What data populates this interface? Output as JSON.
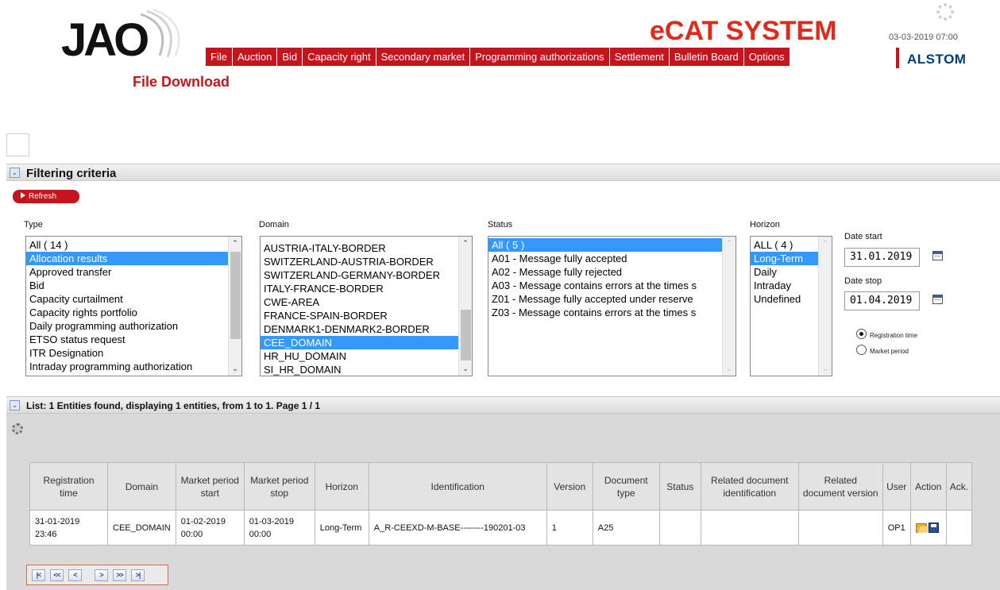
{
  "header": {
    "logo_text": "JAO",
    "page_title": "File Download",
    "system_title": "eCAT SYSTEM",
    "datetime": "03-03-2019 07:00",
    "brand": "ALSTOM",
    "menu": [
      "File",
      "Auction",
      "Bid",
      "Capacity right",
      "Secondary market",
      "Programming authorizations",
      "Settlement",
      "Bulletin Board",
      "Options"
    ],
    "accent_color": "#c4151c"
  },
  "filter": {
    "section_title": "Filtering criteria",
    "refresh_label": "Refresh",
    "type": {
      "label": "Type",
      "options": [
        "All ( 14 )",
        "Allocation results",
        "Approved transfer",
        "Bid",
        "Capacity curtailment",
        "Capacity rights portfolio",
        "Daily programming authorization",
        "ETSO status request",
        "ITR Designation",
        "Intraday programming authorization"
      ],
      "selected": "Allocation results"
    },
    "domain": {
      "label": "Domain",
      "options": [
        "AUSTRIA-ITALY-BORDER",
        "SWITZERLAND-AUSTRIA-BORDER",
        "SWITZERLAND-GERMANY-BORDER",
        "ITALY-FRANCE-BORDER",
        "CWE-AREA",
        "FRANCE-SPAIN-BORDER",
        "DENMARK1-DENMARK2-BORDER",
        "CEE_DOMAIN",
        "HR_HU_DOMAIN",
        "SI_HR_DOMAIN"
      ],
      "selected": "CEE_DOMAIN"
    },
    "status": {
      "label": "Status",
      "options": [
        "All ( 5 )",
        "A01 - Message fully accepted",
        "A02 - Message fully rejected",
        "A03 - Message contains errors at the times s",
        "Z01 - Message fully accepted under reserve",
        "Z03 - Message contains errors at the times s"
      ],
      "selected": "All ( 5 )"
    },
    "horizon": {
      "label": "Horizon",
      "options": [
        "ALL ( 4 )",
        "Long-Term",
        "Daily",
        "Intraday",
        "Undefined"
      ],
      "selected": "Long-Term"
    },
    "date_start_label": "Date start",
    "date_start": "31.01.2019",
    "date_stop_label": "Date stop",
    "date_stop": "01.04.2019",
    "radio_registration": "Registration time",
    "radio_market": "Market period",
    "radio_selected": "Registration time"
  },
  "list": {
    "section_title": "List: 1 Entities found, displaying 1 entities, from 1 to 1. Page 1 / 1",
    "columns": [
      "Registration time",
      "Domain",
      "Market period start",
      "Market period stop",
      "Horizon",
      "Identification",
      "Version",
      "Document type",
      "Status",
      "Related document identification",
      "Related document version",
      "User",
      "Action",
      "Ack."
    ],
    "rows": [
      {
        "registration_time": "31-01-2019 23:46",
        "domain": "CEE_DOMAIN",
        "market_start": "01-02-2019 00:00",
        "market_stop": "01-03-2019 00:00",
        "horizon": "Long-Term",
        "identification": "A_R-CEEXD-M-BASE--------190201-03",
        "version": "1",
        "document_type": "A25",
        "status": "",
        "related_id": "",
        "related_version": "",
        "user": "OP1",
        "ack": ""
      }
    ]
  },
  "pager": {
    "first": "|<",
    "prev_fast": "<<",
    "prev": "<",
    "next": ">",
    "next_fast": ">>",
    "last": ">|"
  }
}
